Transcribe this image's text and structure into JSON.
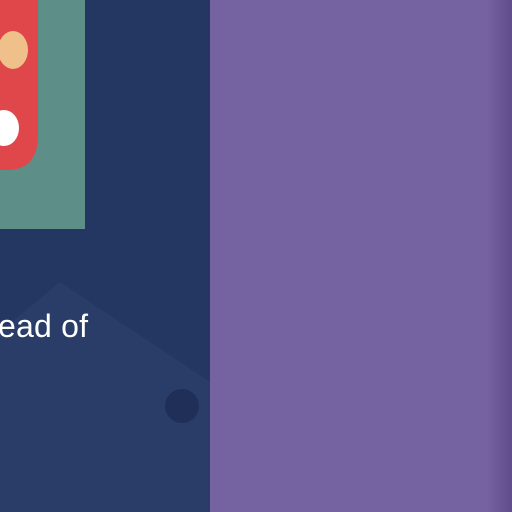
{
  "content": {
    "snippet": "ead of"
  },
  "colors": {
    "left_background": "#243662",
    "right_background": "#7562a0",
    "card_background": "#5d8e88",
    "badge_red": "#e0474a",
    "badge_skin": "#efc08a",
    "text": "#ffffff"
  },
  "icons": {
    "decorative_tag": "tag-icon",
    "card_illustration": "character-illustration-icon"
  }
}
